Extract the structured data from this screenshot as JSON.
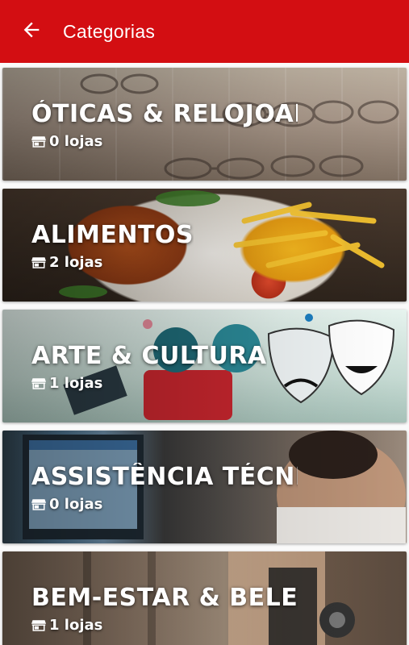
{
  "appbar": {
    "title": "Categorias",
    "back_icon": "arrow-left-icon",
    "background": "#d30e12"
  },
  "categories": [
    {
      "title": "ÓTICAS & RELOJOARIA",
      "count_label": "0 lojas",
      "icon": "store-icon"
    },
    {
      "title": "ALIMENTOS",
      "count_label": "2 lojas",
      "icon": "store-icon"
    },
    {
      "title": "ARTE & CULTURA",
      "count_label": "1 lojas",
      "icon": "store-icon"
    },
    {
      "title": "ASSISTÊNCIA TÉCNI",
      "count_label": "0 lojas",
      "icon": "store-icon"
    },
    {
      "title": "BEM-ESTAR & BELEZA",
      "count_label": "1 lojas",
      "icon": "store-icon"
    }
  ]
}
